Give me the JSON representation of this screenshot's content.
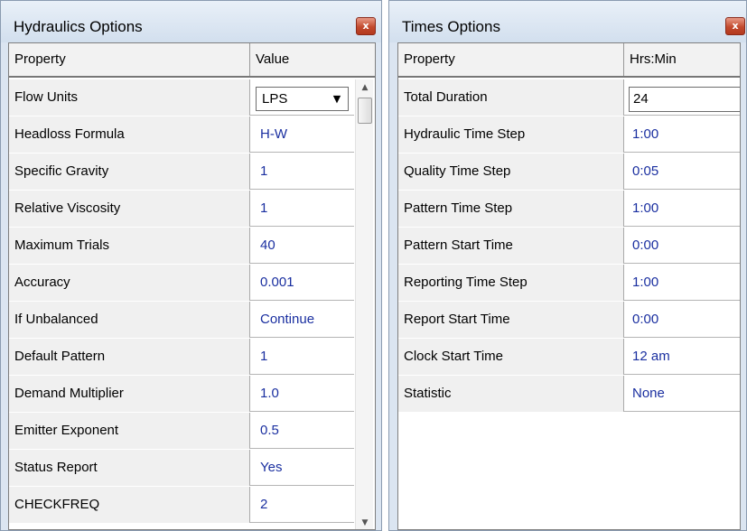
{
  "hydraulics": {
    "title": "Hydraulics Options",
    "close_label": "x",
    "columns": {
      "property": "Property",
      "value": "Value"
    },
    "rows": [
      {
        "property": "Flow Units",
        "value": "LPS"
      },
      {
        "property": "Headloss Formula",
        "value": "H-W"
      },
      {
        "property": "Specific Gravity",
        "value": "1"
      },
      {
        "property": "Relative Viscosity",
        "value": "1"
      },
      {
        "property": "Maximum Trials",
        "value": "40"
      },
      {
        "property": "Accuracy",
        "value": "0.001"
      },
      {
        "property": "If Unbalanced",
        "value": "Continue"
      },
      {
        "property": "Default Pattern",
        "value": "1"
      },
      {
        "property": "Demand Multiplier",
        "value": "1.0"
      },
      {
        "property": "Emitter Exponent",
        "value": "0.5"
      },
      {
        "property": "Status Report",
        "value": "Yes"
      },
      {
        "property": "CHECKFREQ",
        "value": "2"
      }
    ],
    "scrollbar": {
      "up_icon": "▲",
      "down_icon": "▼"
    },
    "dropdown_icon": "▼"
  },
  "times": {
    "title": "Times Options",
    "close_label": "x",
    "columns": {
      "property": "Property",
      "value": "Hrs:Min"
    },
    "rows": [
      {
        "property": "Total Duration",
        "value": "24"
      },
      {
        "property": "Hydraulic Time Step",
        "value": "1:00"
      },
      {
        "property": "Quality Time Step",
        "value": "0:05"
      },
      {
        "property": "Pattern Time Step",
        "value": "1:00"
      },
      {
        "property": "Pattern Start Time",
        "value": "0:00"
      },
      {
        "property": "Reporting Time Step",
        "value": "1:00"
      },
      {
        "property": "Report Start Time",
        "value": "0:00"
      },
      {
        "property": "Clock Start Time",
        "value": "12 am"
      },
      {
        "property": "Statistic",
        "value": "None"
      }
    ]
  },
  "colors": {
    "value_text": "#1a2fa0",
    "close_button": "#c24a2e",
    "window_frame": "#dbe5f1"
  }
}
